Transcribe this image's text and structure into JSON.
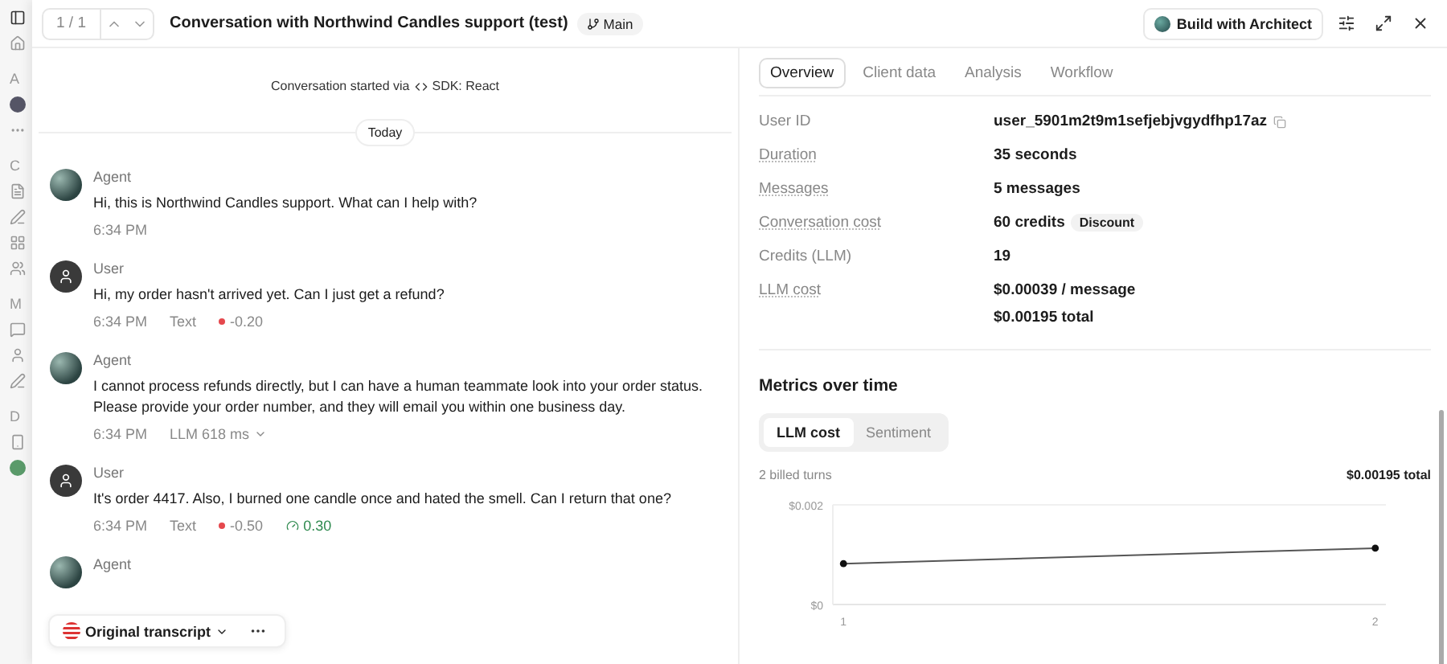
{
  "sidebar": {
    "sections": [
      {
        "label": "A"
      },
      {
        "label": "C"
      },
      {
        "label": "M"
      },
      {
        "label": "D"
      }
    ]
  },
  "header": {
    "counter": "1 / 1",
    "title": "Conversation with Northwind Candles support (test)",
    "branch": "Main",
    "architect_button": "Build with Architect"
  },
  "conversation": {
    "started_text": "Conversation started via",
    "started_source": "SDK: React",
    "date_label": "Today",
    "messages": [
      {
        "kind": "agent",
        "author": "Agent",
        "text": "Hi, this is Northwind Candles support. What can I help with?",
        "time": "6:34 PM"
      },
      {
        "kind": "user",
        "author": "User",
        "text": "Hi, my order hasn't arrived yet. Can I just get a refund?",
        "time": "6:34 PM",
        "meta": [
          {
            "kind": "text",
            "text": "Text"
          },
          {
            "kind": "sentiment",
            "text": "-0.20",
            "color": "#e5484d"
          }
        ]
      },
      {
        "kind": "agent",
        "author": "Agent",
        "text": "I cannot process refunds directly, but I can have a human teammate look into your order status. Please provide your order number, and they will email you within one business day.",
        "time": "6:34 PM",
        "meta": [
          {
            "kind": "latency",
            "text": "LLM 618 ms"
          }
        ]
      },
      {
        "kind": "user",
        "author": "User",
        "text": "It's order 4417. Also, I burned one candle once and hated the smell. Can I return that one?",
        "time": "6:34 PM",
        "meta": [
          {
            "kind": "text",
            "text": "Text"
          },
          {
            "kind": "sentiment",
            "text": "-0.50",
            "color": "#e5484d"
          },
          {
            "kind": "score",
            "text": "0.30"
          }
        ]
      },
      {
        "kind": "agent",
        "author": "Agent"
      }
    ],
    "transcript_button": "Original transcript"
  },
  "details": {
    "tabs": [
      {
        "label": "Overview",
        "selected": true
      },
      {
        "label": "Client data",
        "selected": false
      },
      {
        "label": "Analysis",
        "selected": false
      },
      {
        "label": "Workflow",
        "selected": false
      }
    ],
    "fields": [
      {
        "label": "User ID",
        "values": [
          "user_5901m2t9m1sefjebjvgydfhp17az"
        ],
        "copyable": true,
        "underlined": false
      },
      {
        "label": "Duration",
        "values": [
          "35 seconds"
        ],
        "underlined": true
      },
      {
        "label": "Messages",
        "values": [
          "5 messages"
        ],
        "underlined": true
      },
      {
        "label": "Conversation cost",
        "values": [
          "60 credits"
        ],
        "badge": "Discount",
        "underlined": true
      },
      {
        "label": "Credits (LLM)",
        "values": [
          "19"
        ],
        "underlined": false
      },
      {
        "label": "LLM cost",
        "values": [
          "$0.00039 / message",
          "$0.00195 total"
        ],
        "underlined": true
      }
    ],
    "metrics": {
      "title": "Metrics over time",
      "toggles": [
        {
          "label": "LLM cost",
          "selected": true
        },
        {
          "label": "Sentiment",
          "selected": false
        }
      ],
      "caption": "2 billed turns",
      "total": "$0.00195 total",
      "chart_data": {
        "type": "line",
        "x": [
          1,
          2
        ],
        "series": [
          {
            "color": "#555555",
            "marker": "circle",
            "values": [
              0.00082,
              0.00113
            ]
          }
        ],
        "xlim": [
          0.98,
          2.02
        ],
        "ylim": [
          0,
          0.002
        ],
        "yticks": [
          {
            "value": 0,
            "label": "$0"
          },
          {
            "value": 0.002,
            "label": "$0.002"
          }
        ],
        "xticks": [
          1,
          2
        ]
      }
    }
  }
}
